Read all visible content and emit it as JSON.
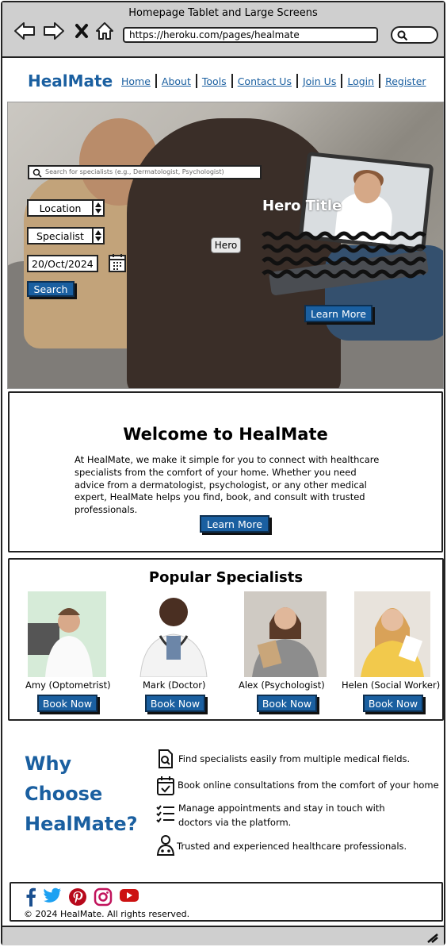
{
  "browser": {
    "window_title": "Homepage Tablet and Large Screens",
    "url": "https://heroku.com/pages/healmate"
  },
  "header": {
    "brand": "HealMate",
    "nav": [
      "Home",
      "About",
      "Tools",
      "Contact Us",
      "Join Us",
      "Login",
      "Register"
    ]
  },
  "hero": {
    "search_placeholder": "Search for specialists (e.g., Dermatologist, Psychologist)",
    "location_label": "Location",
    "specialist_label": "Specialist",
    "date_value": "20/Oct/2024",
    "search_button": "Search",
    "badge": "Hero",
    "title": "Hero Title",
    "learn_more": "Learn More"
  },
  "welcome": {
    "title": "Welcome to HealMate",
    "body": "At HealMate, we make it simple for you to connect with healthcare specialists from the comfort of your home. Whether you need advice from a dermatologist, psychologist, or any other medical expert, HealMate helps you find, book, and consult with trusted professionals.",
    "button": "Learn More"
  },
  "specialists": {
    "title": "Popular Specialists",
    "items": [
      {
        "name": "Amy (Optometrist)",
        "button": "Book Now"
      },
      {
        "name": "Mark (Doctor)",
        "button": "Book Now"
      },
      {
        "name": "Alex (Psychologist)",
        "button": "Book Now"
      },
      {
        "name": "Helen (Social Worker)",
        "button": "Book Now"
      }
    ]
  },
  "why": {
    "title_line1": "Why",
    "title_line2": "Choose",
    "title_line3": "HealMate?",
    "items": [
      {
        "icon": "search-document-icon",
        "text": "Find specialists easily from multiple medical fields."
      },
      {
        "icon": "calendar-check-icon",
        "text": "Book online consultations from the comfort of your home"
      },
      {
        "icon": "checklist-icon",
        "text": "Manage appointments and stay in touch with doctors via the platform."
      },
      {
        "icon": "doctor-icon",
        "text": "Trusted and experienced healthcare professionals."
      }
    ]
  },
  "footer": {
    "social": [
      "facebook-icon",
      "twitter-icon",
      "pinterest-icon",
      "instagram-icon",
      "youtube-icon"
    ],
    "copyright": "© 2024 HealMate. All rights reserved."
  },
  "colors": {
    "brand_blue": "#1a5fa0",
    "chrome_grey": "#cfcfcf"
  }
}
